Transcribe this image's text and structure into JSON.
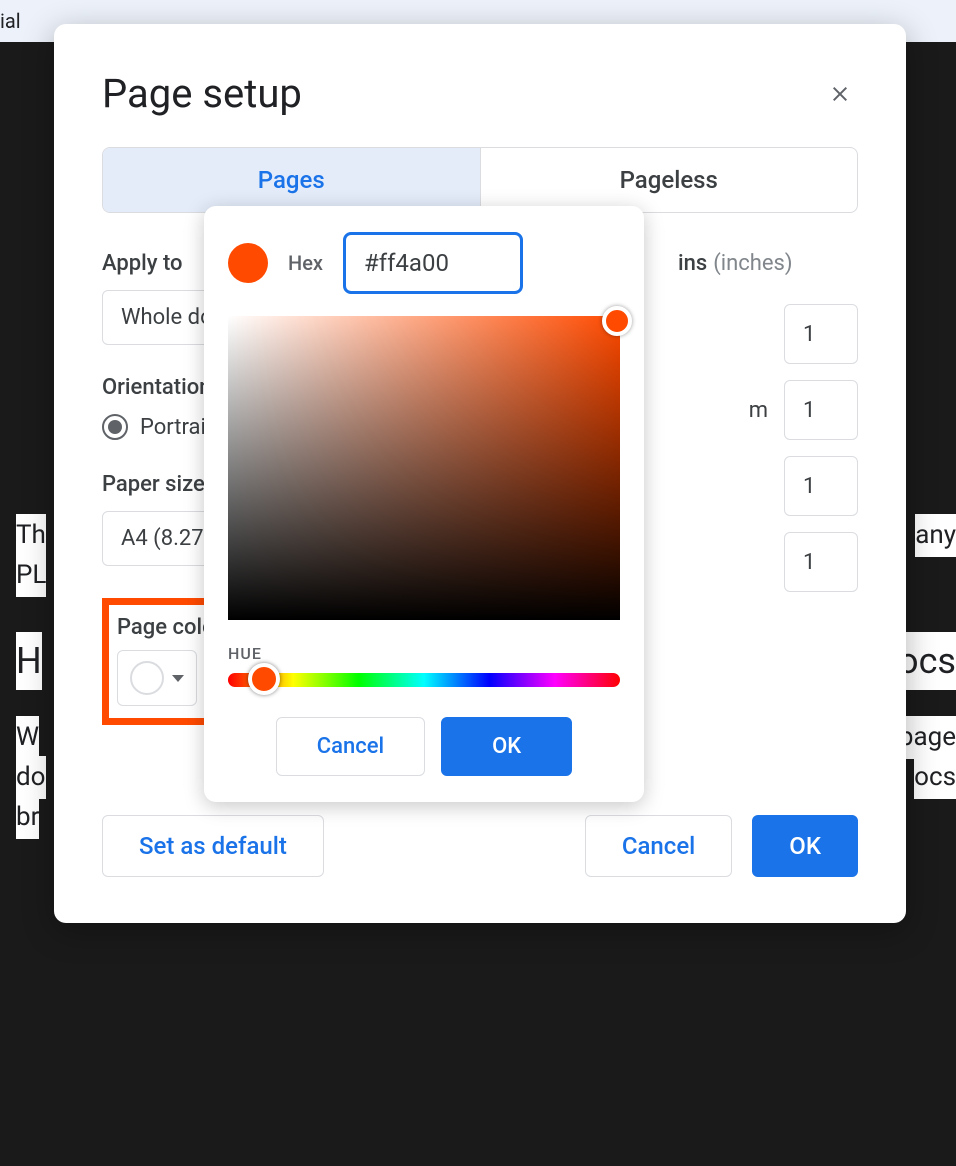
{
  "dialog": {
    "title": "Page setup",
    "tabs": {
      "pages": "Pages",
      "pageless": "Pageless"
    },
    "apply_to_label": "Apply to",
    "apply_to_value": "Whole doc",
    "orientation_label": "Orientation",
    "orientation_value": "Portrait",
    "paper_size_label": "Paper size",
    "paper_size_value": "A4 (8.27\" x",
    "page_color_label": "Page color",
    "margins_label": "ins",
    "margins_unit": "(inches)",
    "margins_bottom_label": "m",
    "margin_values": {
      "top": "1",
      "bottom": "1",
      "left": "1",
      "right": "1"
    },
    "set_default": "Set as default",
    "cancel": "Cancel",
    "ok": "OK"
  },
  "colorpicker": {
    "hex_label": "Hex",
    "hex_value": "#ff4a00",
    "hue_label": "HUE",
    "cancel": "Cancel",
    "ok": "OK",
    "swatch_color": "#ff4a00"
  },
  "background": {
    "toolbar_font": "ial",
    "text1a": "Th",
    "text1b": "any",
    "text2": "PL",
    "heading_a": "H",
    "heading_b": "ocs",
    "text3a": "W",
    "text3b": "page",
    "text4a": "do",
    "text4b": "ocs",
    "text5": "br"
  }
}
